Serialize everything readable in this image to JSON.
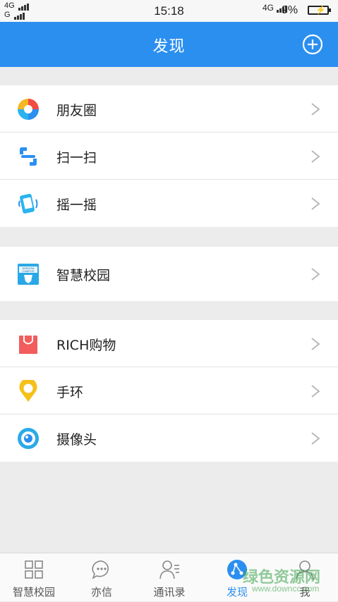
{
  "status": {
    "left_top": "4G",
    "left_bottom": "G",
    "time": "15:18",
    "network": "4G",
    "battery": "9%"
  },
  "header": {
    "title": "发现"
  },
  "groups": [
    [
      {
        "label": "朋友圈",
        "icon": "moments-icon"
      },
      {
        "label": "扫一扫",
        "icon": "scan-icon"
      },
      {
        "label": "摇一摇",
        "icon": "shake-icon"
      }
    ],
    [
      {
        "label": "智慧校园",
        "icon": "wisdom-campus-icon",
        "icon_text_1": "WISDOM",
        "icon_text_2": "CAMPUS"
      }
    ],
    [
      {
        "label": "RICH购物",
        "icon": "shopping-bag-icon"
      },
      {
        "label": "手环",
        "icon": "location-pin-icon"
      },
      {
        "label": "摄像头",
        "icon": "camera-icon"
      }
    ]
  ],
  "tabs": [
    {
      "label": "智慧校园",
      "icon": "grid-icon",
      "active": false
    },
    {
      "label": "亦信",
      "icon": "chat-icon",
      "active": false
    },
    {
      "label": "通讯录",
      "icon": "contacts-icon",
      "active": false
    },
    {
      "label": "发现",
      "icon": "discover-icon",
      "active": true
    },
    {
      "label": "我",
      "icon": "profile-icon",
      "active": false
    }
  ],
  "watermark": {
    "text": "绿色资源网",
    "url": "www.downcc.com"
  },
  "colors": {
    "accent": "#2b8ff0",
    "background": "#ececec"
  }
}
